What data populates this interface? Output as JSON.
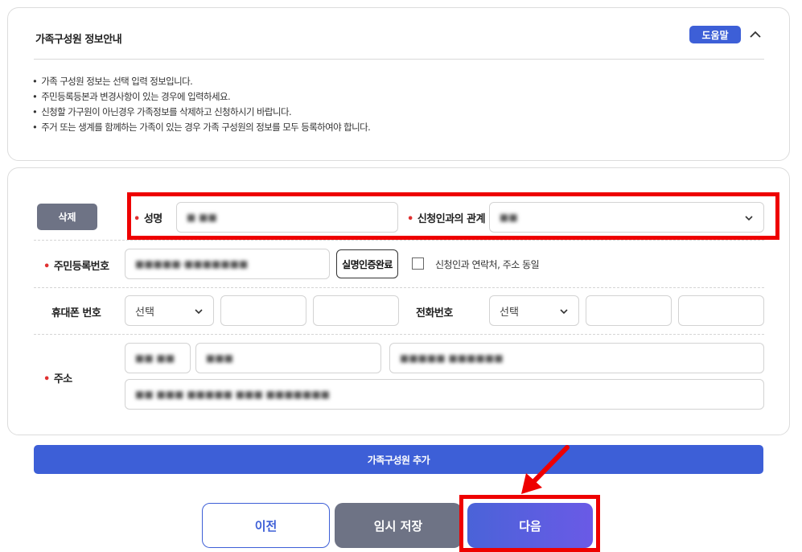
{
  "info": {
    "title": "가족구성원 정보안내",
    "help_label": "도움말",
    "notes": [
      "가족 구성원 정보는 선택 입력 정보입니다.",
      "주민등록등본과 변경사항이 있는 경우에 입력하세요.",
      "신청할 가구원이 아닌경우 가족정보를 삭제하고 신청하시기 바랍니다.",
      "주거 또는 생계를 함께하는 가족이 있는 경우 가족 구성원의 정보를 모두 등록하여야 합니다."
    ]
  },
  "form": {
    "delete_label": "삭제",
    "name_label": "성명",
    "name_value": "■ ■■",
    "relation_label": "신청인과의 관계",
    "relation_value": "■■",
    "rrn_label": "주민등록번호",
    "rrn_value": "■■■■■-■■■■■■■",
    "verify_label": "실명인증완료",
    "same_as_applicant_label": "신청인과 연락처, 주소 동일",
    "mobile_label": "휴대폰 번호",
    "mobile_prefix_value": "선택",
    "phone_label": "전화번호",
    "phone_prefix_value": "선택",
    "address_label": "주소",
    "address_zip": "■■ ■■",
    "address_code": "■■■",
    "address_road": "■■■■■ ■■■■■■",
    "address_detail": "■■ ■■■ ■■■■■ ■■■ ■■■■■■■"
  },
  "actions": {
    "add_member_label": "가족구성원 추가",
    "prev_label": "이전",
    "temp_save_label": "임시 저장",
    "next_label": "다음"
  },
  "colors": {
    "primary": "#3d5fd7",
    "gray_button": "#6e7385",
    "required_mark": "#e03131",
    "highlight": "#ee0000"
  }
}
